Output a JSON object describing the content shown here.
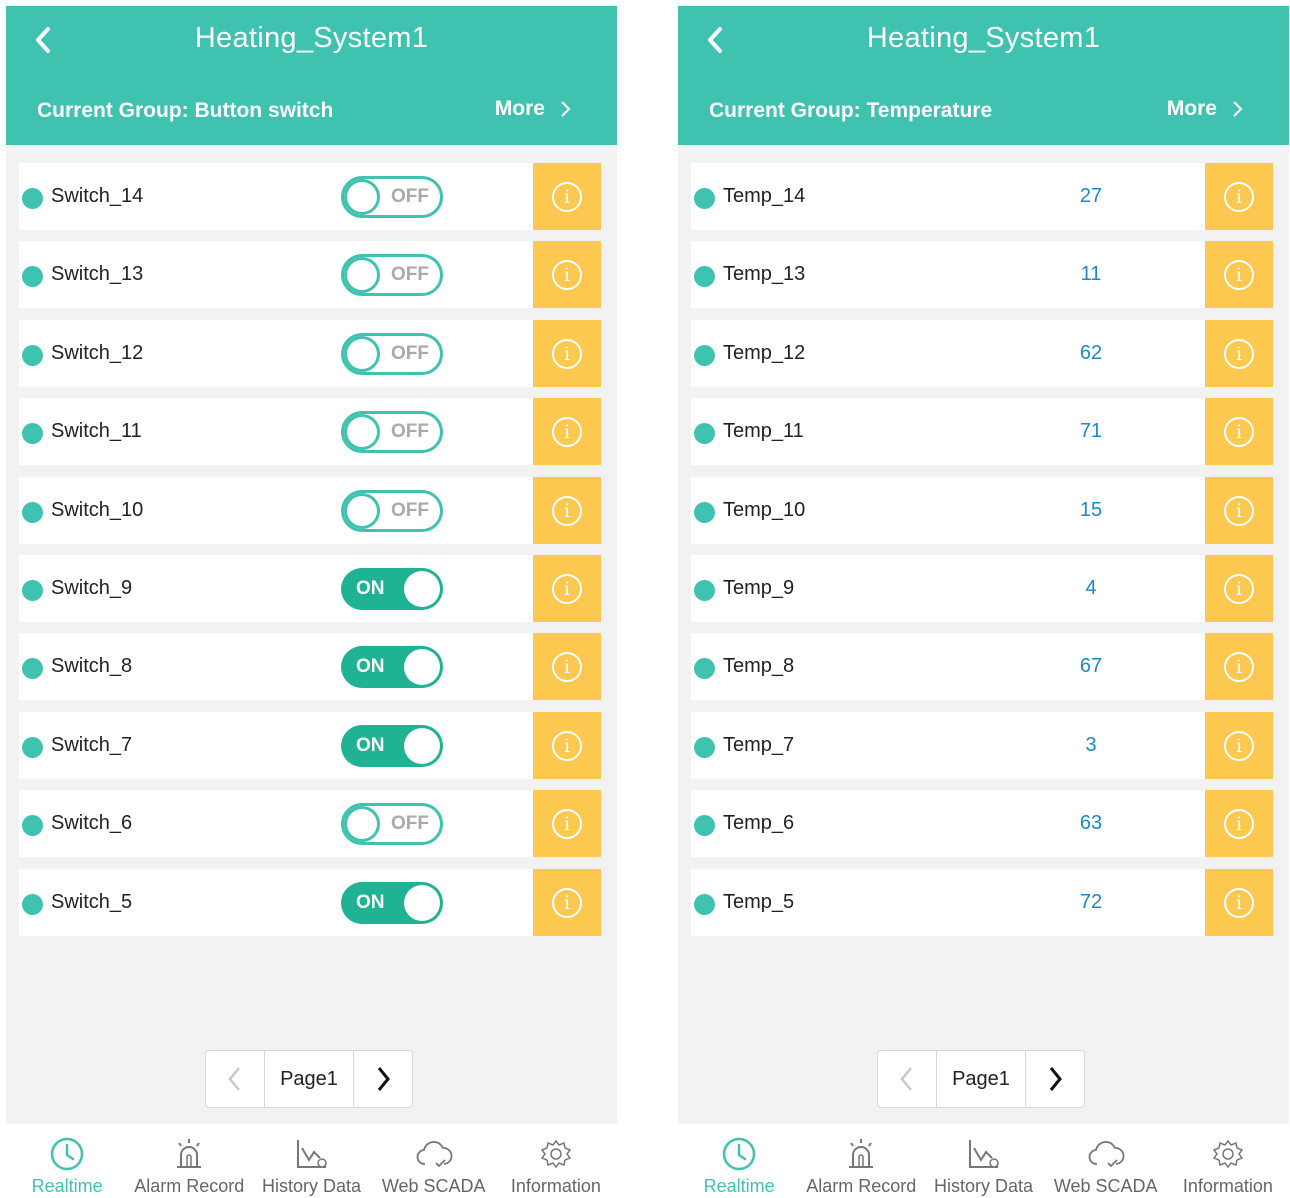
{
  "colors": {
    "accent": "#3fc2b0",
    "toggle_on": "#1fb393",
    "info": "#fdc84f",
    "value_text": "#1e88c7"
  },
  "left": {
    "title": "Heating_System1",
    "group": "Current Group: Button switch",
    "more": "More",
    "rows": [
      {
        "label": "Switch_14",
        "state": "OFF"
      },
      {
        "label": "Switch_13",
        "state": "OFF"
      },
      {
        "label": "Switch_12",
        "state": "OFF"
      },
      {
        "label": "Switch_11",
        "state": "OFF"
      },
      {
        "label": "Switch_10",
        "state": "OFF"
      },
      {
        "label": "Switch_9",
        "state": "ON"
      },
      {
        "label": "Switch_8",
        "state": "ON"
      },
      {
        "label": "Switch_7",
        "state": "ON"
      },
      {
        "label": "Switch_6",
        "state": "OFF"
      },
      {
        "label": "Switch_5",
        "state": "ON"
      }
    ],
    "page": "Page1"
  },
  "right": {
    "title": "Heating_System1",
    "group": "Current Group: Temperature",
    "more": "More",
    "rows": [
      {
        "label": "Temp_14",
        "value": "27"
      },
      {
        "label": "Temp_13",
        "value": "11"
      },
      {
        "label": "Temp_12",
        "value": "62"
      },
      {
        "label": "Temp_11",
        "value": "71"
      },
      {
        "label": "Temp_10",
        "value": "15"
      },
      {
        "label": "Temp_9",
        "value": "4"
      },
      {
        "label": "Temp_8",
        "value": "67"
      },
      {
        "label": "Temp_7",
        "value": "3"
      },
      {
        "label": "Temp_6",
        "value": "63"
      },
      {
        "label": "Temp_5",
        "value": "72"
      }
    ],
    "page": "Page1"
  },
  "info_glyph": "i",
  "tabs": [
    {
      "label": "Realtime",
      "icon": "clock-icon",
      "active": true
    },
    {
      "label": "Alarm Record",
      "icon": "alarm-siren-icon",
      "active": false
    },
    {
      "label": "History Data",
      "icon": "history-chart-icon",
      "active": false
    },
    {
      "label": "Web SCADA",
      "icon": "cloud-icon",
      "active": false
    },
    {
      "label": "Information",
      "icon": "gear-icon",
      "active": false
    }
  ]
}
